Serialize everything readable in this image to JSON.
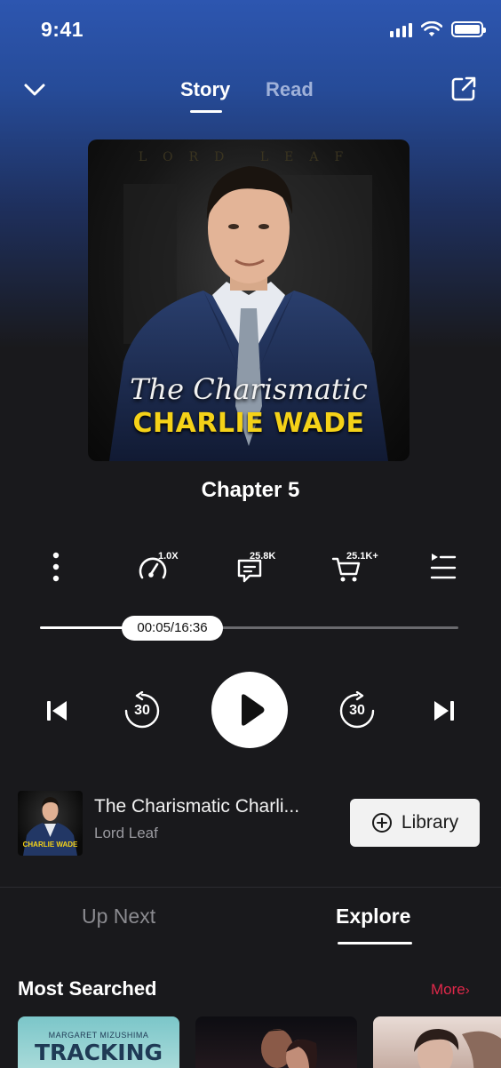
{
  "status": {
    "time": "9:41"
  },
  "nav": {
    "tabs": [
      {
        "label": "Story",
        "active": true
      },
      {
        "label": "Read",
        "active": false
      }
    ]
  },
  "cover": {
    "author_text": "LORD LEAF",
    "title_script": "The Charismatic",
    "title_main": "CHARLIE WADE"
  },
  "chapter": {
    "title": "Chapter 5"
  },
  "controls": {
    "speed_label": "1.0X",
    "comments_count": "25.8K",
    "cart_count": "25.1K+"
  },
  "progress": {
    "time_text": "00:05/16:36",
    "fraction": 0.005
  },
  "player": {
    "rewind_seconds": "30",
    "forward_seconds": "30"
  },
  "book": {
    "title": "The Charismatic Charli...",
    "author": "Lord Leaf",
    "thumb_title": "CHARLIE WADE",
    "library_label": "Library"
  },
  "lower_tabs": [
    {
      "label": "Up Next",
      "active": false
    },
    {
      "label": "Explore",
      "active": true
    }
  ],
  "section": {
    "title": "Most Searched",
    "more_label": "More"
  },
  "cards": [
    {
      "author": "MARGARET MIZUSHIMA",
      "title": "TRACKING GAME"
    },
    {
      "author": "",
      "title": ""
    },
    {
      "author": "",
      "title": ""
    }
  ],
  "colors": {
    "accent_red": "#e0284a",
    "cover_yellow": "#f5d218",
    "gradient_top": "#2d56b0",
    "background": "#19191c"
  }
}
